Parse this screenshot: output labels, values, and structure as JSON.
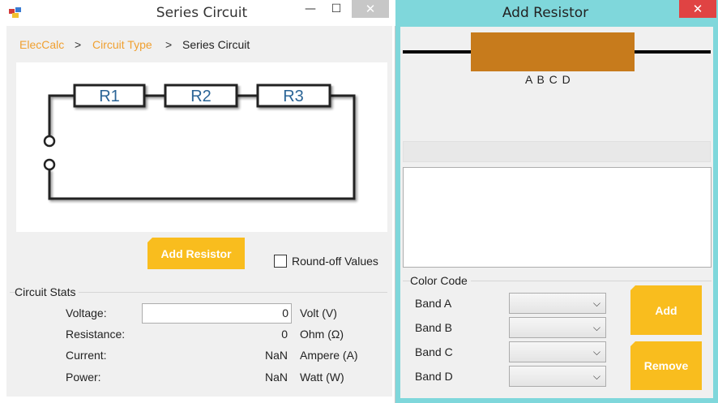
{
  "main_window": {
    "title": "Series Circuit",
    "app_icon": "app-window-icon",
    "caption_buttons": {
      "minimize": "—",
      "maximize": "☐",
      "close": "✕"
    },
    "breadcrumb": [
      {
        "label": "ElecCalc",
        "color": "#f0a030"
      },
      {
        "label": "Circuit Type",
        "color": "#f0a030"
      },
      {
        "label": "Series Circuit",
        "color": "#222222"
      }
    ],
    "breadcrumb_separator": ">",
    "circuit_diagram": {
      "resistor_labels": [
        "R1",
        "R2",
        "R3"
      ],
      "label_color": "#2a6496"
    },
    "add_resistor_label": "Add Resistor",
    "roundoff": {
      "label": "Round-off Values",
      "checked": false
    },
    "stats": {
      "title": "Circuit Stats",
      "rows": [
        {
          "label": "Voltage:",
          "value": "0",
          "unit": "Volt (V)"
        },
        {
          "label": "Resistance:",
          "value": "0",
          "unit": "Ohm (Ω)"
        },
        {
          "label": "Current:",
          "value": "NaN",
          "unit": "Ampere (A)"
        },
        {
          "label": "Power:",
          "value": "NaN",
          "unit": "Watt (W)"
        }
      ]
    }
  },
  "resistor_window": {
    "title": "Add Resistor",
    "caption_close": "✕",
    "band_letters": "A B C D",
    "resistor_body_color": "#c77b1c",
    "color_code": {
      "title": "Color Code",
      "bands": [
        {
          "label": "Band A",
          "selected": ""
        },
        {
          "label": "Band B",
          "selected": ""
        },
        {
          "label": "Band C",
          "selected": ""
        },
        {
          "label": "Band D",
          "selected": ""
        }
      ]
    },
    "add_label": "Add",
    "remove_label": "Remove"
  },
  "colors": {
    "accent": "#f9bd1e",
    "right_frame": "#7fd7db",
    "close_red": "#e04343"
  }
}
